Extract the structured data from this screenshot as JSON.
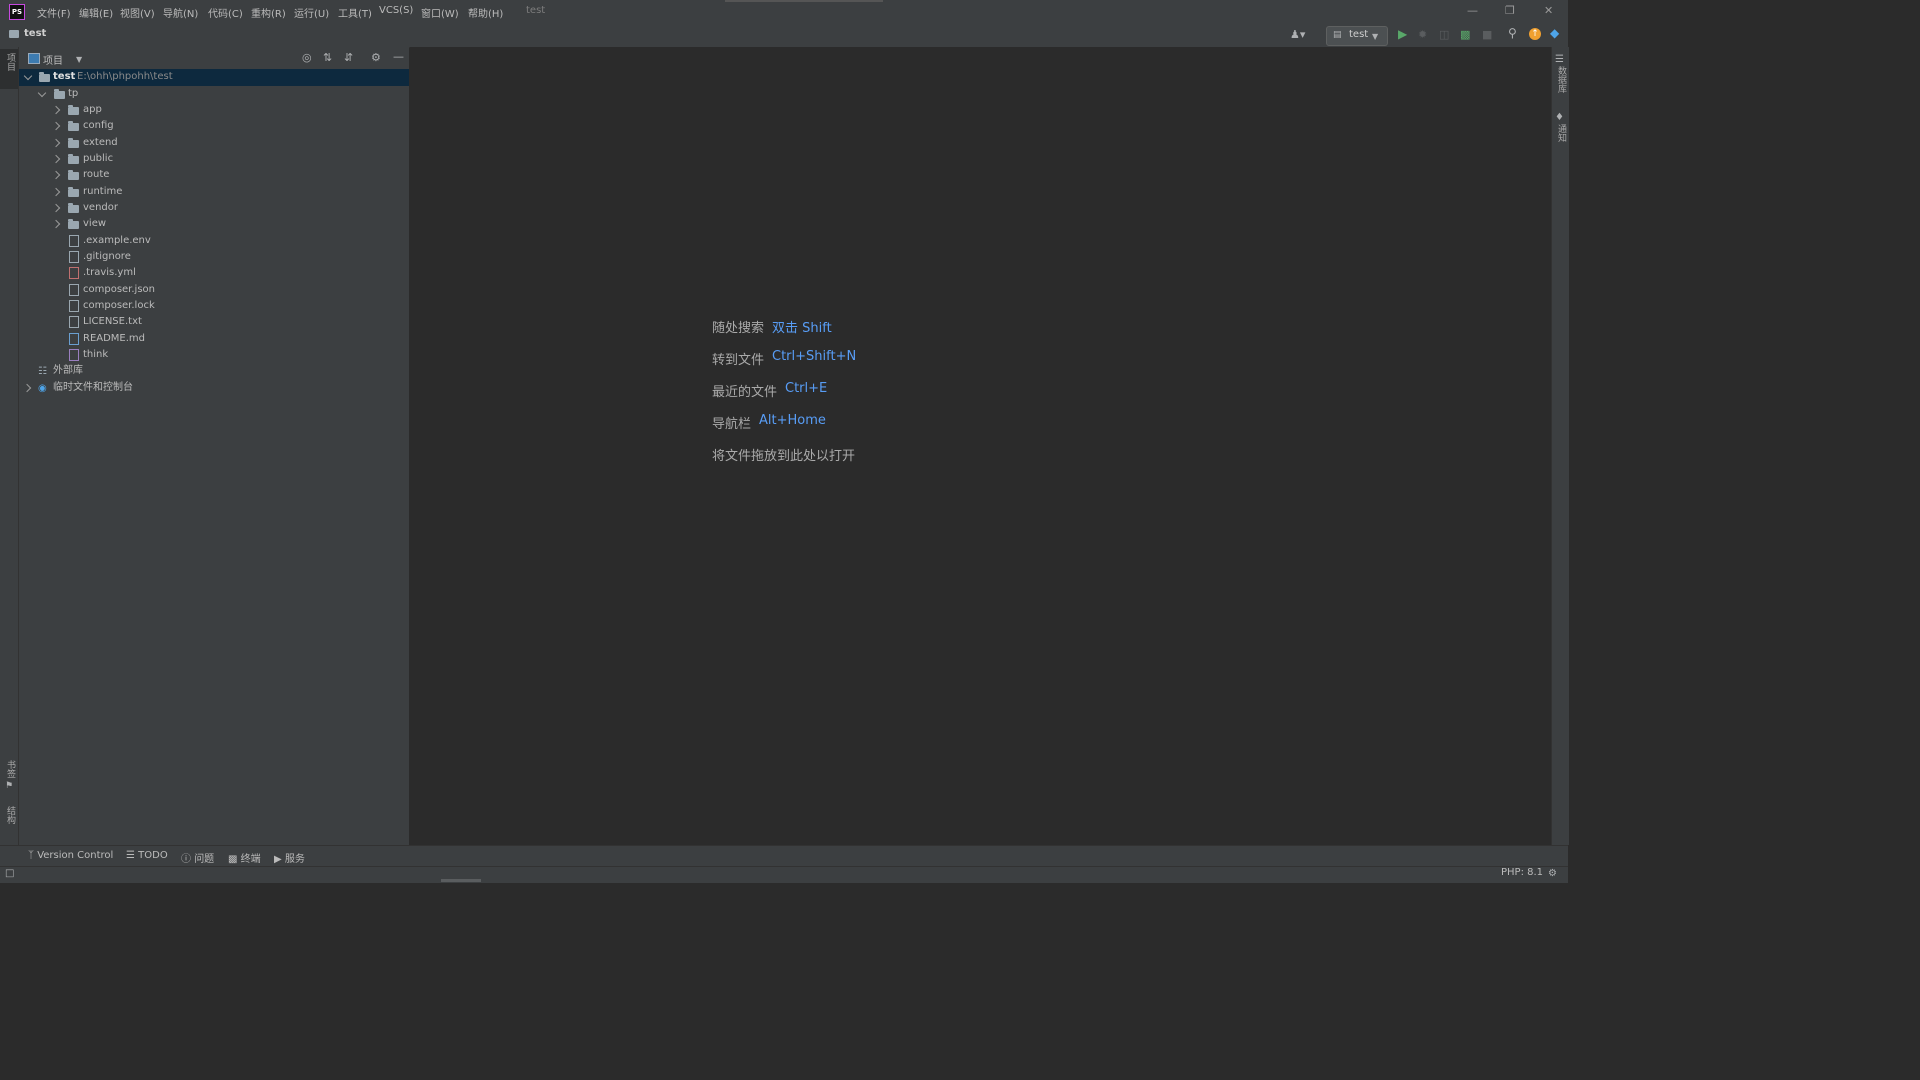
{
  "app": {
    "logo": "PS",
    "window_title": "test"
  },
  "menu": [
    "文件(F)",
    "编辑(E)",
    "视图(V)",
    "导航(N)",
    "代码(C)",
    "重构(R)",
    "运行(U)",
    "工具(T)",
    "VCS(S)",
    "窗口(W)",
    "帮助(H)"
  ],
  "breadcrumb": {
    "project": "test"
  },
  "toolbar": {
    "run_config": "test"
  },
  "left_strip": {
    "project_tab": "项目",
    "bookmarks_tab": "书签",
    "structure_tab": "结构"
  },
  "right_strip": {
    "database_tab": "数据库",
    "notifications_tab": "通知"
  },
  "project_panel": {
    "title": "项目",
    "root": {
      "name": "test",
      "path": "E:\\ohh\\phpohh\\test"
    },
    "tp": "tp",
    "folders": [
      "app",
      "config",
      "extend",
      "public",
      "route",
      "runtime",
      "vendor",
      "view"
    ],
    "files": [
      ".example.env",
      ".gitignore",
      ".travis.yml",
      "composer.json",
      "composer.lock",
      "LICENSE.txt",
      "README.md",
      "think"
    ],
    "external_libs": "外部库",
    "scratches": "临时文件和控制台"
  },
  "editor_hints": [
    {
      "label": "随处搜索",
      "key": "双击 Shift"
    },
    {
      "label": "转到文件",
      "key": "Ctrl+Shift+N"
    },
    {
      "label": "最近的文件",
      "key": "Ctrl+E"
    },
    {
      "label": "导航栏",
      "key": "Alt+Home"
    },
    {
      "label": "将文件拖放到此处以打开",
      "key": ""
    }
  ],
  "bottom_tabs": [
    "Version Control",
    "TODO",
    "问题",
    "终端",
    "服务"
  ],
  "status": {
    "php": "PHP: 8.1"
  },
  "colors": {
    "accent_key": "#589df6",
    "selection": "#0d293e",
    "background": "#2b2b2b",
    "panel": "#3c3f41"
  }
}
